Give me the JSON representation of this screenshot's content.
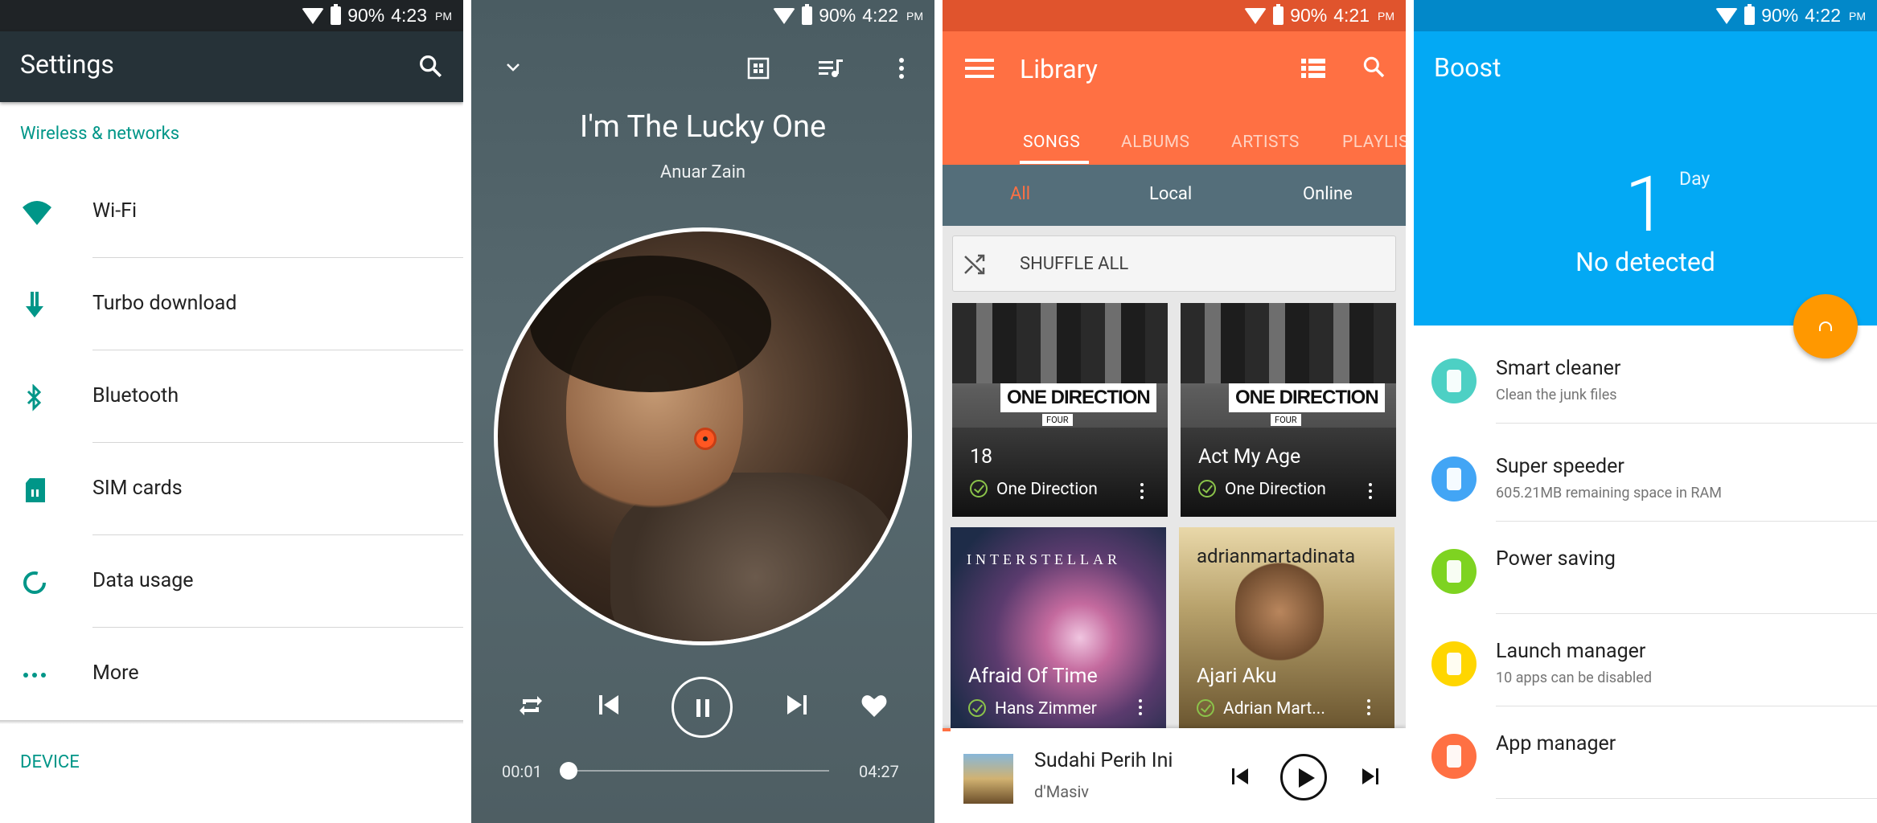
{
  "settings": {
    "status": {
      "battery": "90%",
      "time": "4:23",
      "ampm": "PM"
    },
    "title": "Settings",
    "section_wireless": "Wireless & networks",
    "items": [
      {
        "label": "Wi-Fi",
        "icon": "wifi-icon"
      },
      {
        "label": "Turbo download",
        "icon": "download-arrow-icon"
      },
      {
        "label": "Bluetooth",
        "icon": "bluetooth-icon"
      },
      {
        "label": "SIM cards",
        "icon": "sim-card-icon"
      },
      {
        "label": "Data usage",
        "icon": "data-usage-icon"
      },
      {
        "label": "More",
        "icon": "more-dots-icon"
      }
    ],
    "section_device": "DEVICE",
    "accent": "#009688"
  },
  "player": {
    "status": {
      "battery": "90%",
      "time": "4:22",
      "ampm": "PM"
    },
    "title": "I'm The Lucky One",
    "artist": "Anuar Zain",
    "elapsed": "00:01",
    "duration": "04:27"
  },
  "library": {
    "status": {
      "battery": "90%",
      "time": "4:21",
      "ampm": "PM"
    },
    "title": "Library",
    "tabs": [
      "SONGS",
      "ALBUMS",
      "ARTISTS",
      "PLAYLIS"
    ],
    "filters": [
      "All",
      "Local",
      "Online"
    ],
    "shuffle": "SHUFFLE ALL",
    "cards": [
      {
        "name": "18",
        "artist": "One Direction",
        "logo": "ONE DIRECTION",
        "sub": "FOUR"
      },
      {
        "name": "Act My Age",
        "artist": "One Direction",
        "logo": "ONE DIRECTION",
        "sub": "FOUR"
      },
      {
        "name": "Afraid Of Time",
        "artist": "Hans Zimmer",
        "logo": "INTERSTELLAR"
      },
      {
        "name": "Ajari Aku",
        "artist": "Adrian Mart...",
        "logo": "adrianmartadinata"
      }
    ],
    "now_playing": {
      "song": "Sudahi Perih Ini",
      "artist": "d'Masiv"
    },
    "accent": "#ff7043"
  },
  "boost": {
    "status": {
      "battery": "90%",
      "time": "4:22",
      "ampm": "PM"
    },
    "title": "Boost",
    "days": "1",
    "unit": "Day",
    "state": "No detected",
    "items": [
      {
        "title": "Smart cleaner",
        "sub": "Clean the junk files",
        "color": "#4dd0c4"
      },
      {
        "title": "Super speeder",
        "sub": "605.21MB remaining space in RAM",
        "color": "#42a5f5"
      },
      {
        "title": "Power saving",
        "sub": "",
        "color": "#7ed321"
      },
      {
        "title": "Launch manager",
        "sub": "10 apps can be disabled",
        "color": "#ffd600"
      },
      {
        "title": "App manager",
        "sub": "",
        "color": "#ff7043"
      }
    ],
    "accent": "#03a9f4"
  }
}
